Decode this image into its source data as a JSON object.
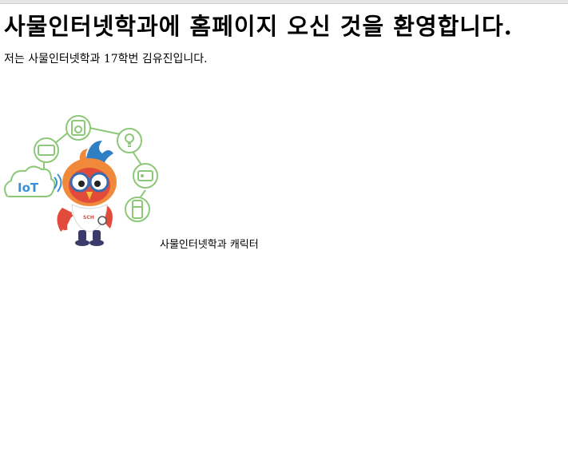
{
  "page": {
    "heading": "사물인터넷학과에 홈페이지 오신 것을 환영합니다.",
    "intro": "저는 사물인터넷학과 17학번 김유진입니다.",
    "caption": "사물인터넷학과 캐릭터"
  },
  "mascot_image": {
    "badge_text": "IoT",
    "shirt_text": "SCH",
    "colors": {
      "line_green": "#8cc878",
      "iot_blue": "#3a8fd6",
      "owl_red": "#e24a3a",
      "owl_orange": "#f08a3a",
      "crest_blue": "#2f7fc4",
      "glasses": "#3a6bb0",
      "shirt": "#ffffff",
      "pants": "#3b3b6b"
    }
  }
}
